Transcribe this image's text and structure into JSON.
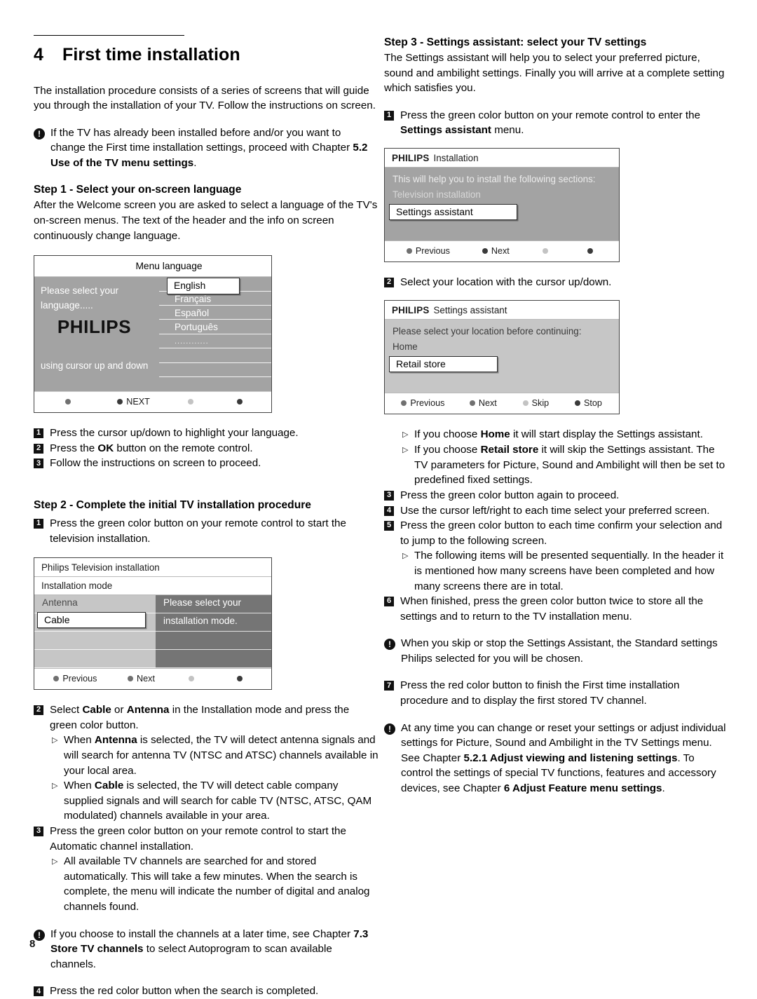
{
  "page": {
    "number": "8"
  },
  "chapter": {
    "num": "4",
    "title": "First time installation"
  },
  "left": {
    "intro": "The installation procedure consists of a series of screens that will guide you through the installation of your TV. Follow the instructions on screen.",
    "note1_a": "If the TV has already been installed before and/or you want to change the First time installation settings, proceed with Chapter ",
    "note1_b": "5.2",
    "note1_c": "Use of the TV menu settings",
    "note1_d": ".",
    "step1_title": "Step 1 - Select your on-screen language",
    "step1_body": "After the Welcome screen you are asked to select a language of the TV's on-screen menus. The text of the header and the info on screen continuously change language.",
    "step1_items": [
      "Press the cursor up/down to highlight your language.",
      "Press the OK button on the remote control.",
      "Follow the instructions on screen to proceed."
    ],
    "step1_item2_pre": "Press the ",
    "step1_item2_bold": "OK",
    "step1_item2_post": " button on the remote control.",
    "step2_title": "Step 2 - Complete the initial TV installation procedure",
    "step2_item1": "Press the green color button on your remote control to start the television installation.",
    "step2_item2_pre": "Select ",
    "step2_item2_b1": "Cable",
    "step2_item2_mid": " or ",
    "step2_item2_b2": "Antenna",
    "step2_item2_post": " in the Installation mode and press the green color button.",
    "step2_b1_pre": "When ",
    "step2_b1_bold": "Antenna",
    "step2_b1_post": " is selected, the TV will detect antenna signals and will search for antenna TV (NTSC and ATSC) channels available in your local area.",
    "step2_b2_pre": "When ",
    "step2_b2_bold": "Cable",
    "step2_b2_post": " is selected, the TV will detect cable company supplied signals and will search for cable TV (NTSC, ATSC, QAM modulated) channels available in your area.",
    "step2_item3": "Press the green color button on your remote control to start the Automatic channel installation.",
    "step2_b3": "All available  TV channels  are searched for and stored automatically. This will take a few minutes. When the search is complete, the menu will indicate the number of digital and analog channels found.",
    "note2_a": "If you choose to install the channels at a later time, see Chapter ",
    "note2_b": "7.3",
    "note2_c": "Store TV channels",
    "note2_d": " to select Autoprogram to scan available channels.",
    "step2_item4": "Press the red color button when the search is completed."
  },
  "right": {
    "step3_title": "Step 3 - Settings assistant: select your TV settings",
    "step3_body": "The Settings assistant will help you to select your preferred picture, sound and ambilight settings. Finally you will arrive at a complete setting which satisfies you.",
    "step3_item1_pre": "Press the green color button on your remote control to enter the ",
    "step3_item1_bold": "Settings assistant",
    "step3_item1_post": " menu.",
    "step3_item2": "Select your location with the cursor up/down.",
    "b_home_pre": "If you choose ",
    "b_home_bold": "Home",
    "b_home_post": " it will start display the Settings assistant.",
    "b_retail_pre": "If you choose ",
    "b_retail_bold": "Retail store",
    "b_retail_post": " it will skip the Settings assistant. The TV parameters for Picture, Sound and Ambilight will then be set to predefined fixed settings.",
    "step3_item3": "Press the green color button again to proceed.",
    "step3_item4": "Use the cursor left/right to each time select your preferred screen.",
    "step3_item5": "Press the green color button to each time confirm your selection and to jump to the following screen.",
    "step3_b_seq": "The following items will be presented sequentially. In the header it is mentioned how many screens have been completed and how many screens there are in total.",
    "step3_item6": "When finished, press the green color button twice to store all the settings and to return to the TV installation menu.",
    "note3": "When you skip or stop the Settings Assistant, the Standard settings Philips selected for you will be chosen.",
    "step3_item7": "Press the red color button to finish the First time installation procedure and to display the first stored TV channel.",
    "note4_a": "At any time you can change or reset your settings or adjust individual settings for Picture, Sound and Ambilight in the TV Settings menu. See Chapter ",
    "note4_b": "5.2.1 Adjust viewing and listening settings",
    "note4_c": ". To control the settings of special TV functions, features and accessory devices, see Chapter ",
    "note4_d": "6 Adjust Feature menu settings",
    "note4_e": "."
  },
  "mock_menu_language": {
    "header": "Menu language",
    "left_line1": "Please select your",
    "left_line2": "language.....",
    "logo": "PHILIPS",
    "cue": "using cursor up and down",
    "selected": "English",
    "options": [
      "English",
      "Français",
      "Español",
      "Português",
      "............"
    ],
    "footer": {
      "next": "NEXT"
    }
  },
  "mock_installation_mode": {
    "title": "Philips Television installation",
    "subtitle": "Installation mode",
    "options": [
      "Antenna",
      "Cable"
    ],
    "selected": "Cable",
    "info_line1": "Please select your",
    "info_line2": "installation mode.",
    "footer": {
      "previous": "Previous",
      "next": "Next"
    }
  },
  "mock_philips_installation": {
    "brand": "PHILIPS",
    "title": "Installation",
    "line1": "This will help you to install the following sections:",
    "line2": "Television installation",
    "selected": "Settings assistant",
    "footer": {
      "previous": "Previous",
      "next": "Next"
    }
  },
  "mock_settings_assistant": {
    "brand": "PHILIPS",
    "title": "Settings assistant",
    "line1": "Please select your location before continuing:",
    "line2": "Home",
    "selected": "Retail store",
    "footer": {
      "previous": "Previous",
      "next": "Next",
      "skip": "Skip",
      "stop": "Stop"
    }
  },
  "glyphs": {
    "triangle": "▷",
    "warn": "!"
  }
}
